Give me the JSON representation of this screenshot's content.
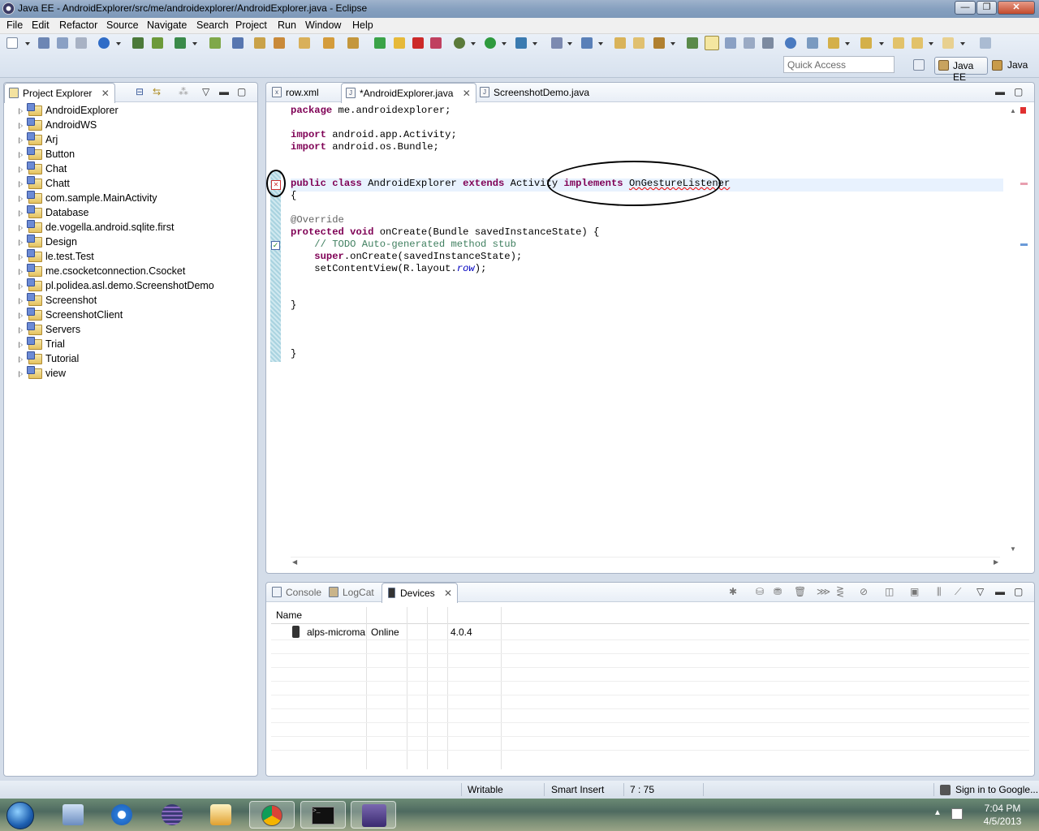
{
  "window": {
    "title": "Java EE - AndroidExplorer/src/me/androidexplorer/AndroidExplorer.java - Eclipse"
  },
  "menu": [
    "File",
    "Edit",
    "Refactor",
    "Source",
    "Navigate",
    "Search",
    "Project",
    "Run",
    "Window",
    "Help"
  ],
  "toolbar": {
    "quick_access_placeholder": "Quick Access",
    "perspective_active": "Java EE",
    "perspective_other": "Java"
  },
  "explorer": {
    "tab_label": "Project Explorer",
    "projects": [
      "AndroidExplorer",
      "AndroidWS",
      "Arj",
      "Button",
      "Chat",
      "Chatt",
      "com.sample.MainActivity",
      "Database",
      "de.vogella.android.sqlite.first",
      "Design",
      "le.test.Test",
      "me.csocketconnection.Csocket",
      "pl.polidea.asl.demo.ScreenshotDemo",
      "Screenshot",
      "ScreenshotClient",
      "Servers",
      "Trial",
      "Tutorial",
      "view"
    ]
  },
  "editor": {
    "tabs": [
      "row.xml",
      "*AndroidExplorer.java",
      "ScreenshotDemo.java"
    ],
    "code": {
      "l1_kw": "package",
      "l1_rest": " me.androidexplorer;",
      "l3_kw": "import",
      "l3_rest": " android.app.Activity;",
      "l4_kw": "import",
      "l4_rest": " android.os.Bundle;",
      "l7_kw1": "public",
      "l7_kw2": "class",
      "l7_name": " AndroidExplorer ",
      "l7_kw3": "extends",
      "l7_mid": " Activity ",
      "l7_kw4": "implements",
      "l7_err": "OnGestureListener",
      "l8": "{",
      "l10": "@Override",
      "l11_kw1": "protected",
      "l11_kw2": "void",
      "l11_rest": " onCreate(Bundle savedInstanceState) {",
      "l12": "    // TODO Auto-generated method stub",
      "l13_kw": "    super",
      "l13_rest": ".onCreate(savedInstanceState);",
      "l14_a": "    setContentView(R.layout.",
      "l14_it": "row",
      "l14_b": ");",
      "l17": "}",
      "l21": "}"
    }
  },
  "bottom": {
    "tabs": [
      "Console",
      "LogCat",
      "Devices"
    ],
    "devices_header": "Name",
    "devices": [
      {
        "name": "alps-microma",
        "state": "Online",
        "version": "4.0.4"
      }
    ]
  },
  "status": {
    "writable": "Writable",
    "insert_mode": "Smart Insert",
    "position": "7 : 75",
    "sign_in": "Sign in to Google..."
  },
  "taskbar": {
    "time": "7:04 PM",
    "date": "4/5/2013"
  }
}
